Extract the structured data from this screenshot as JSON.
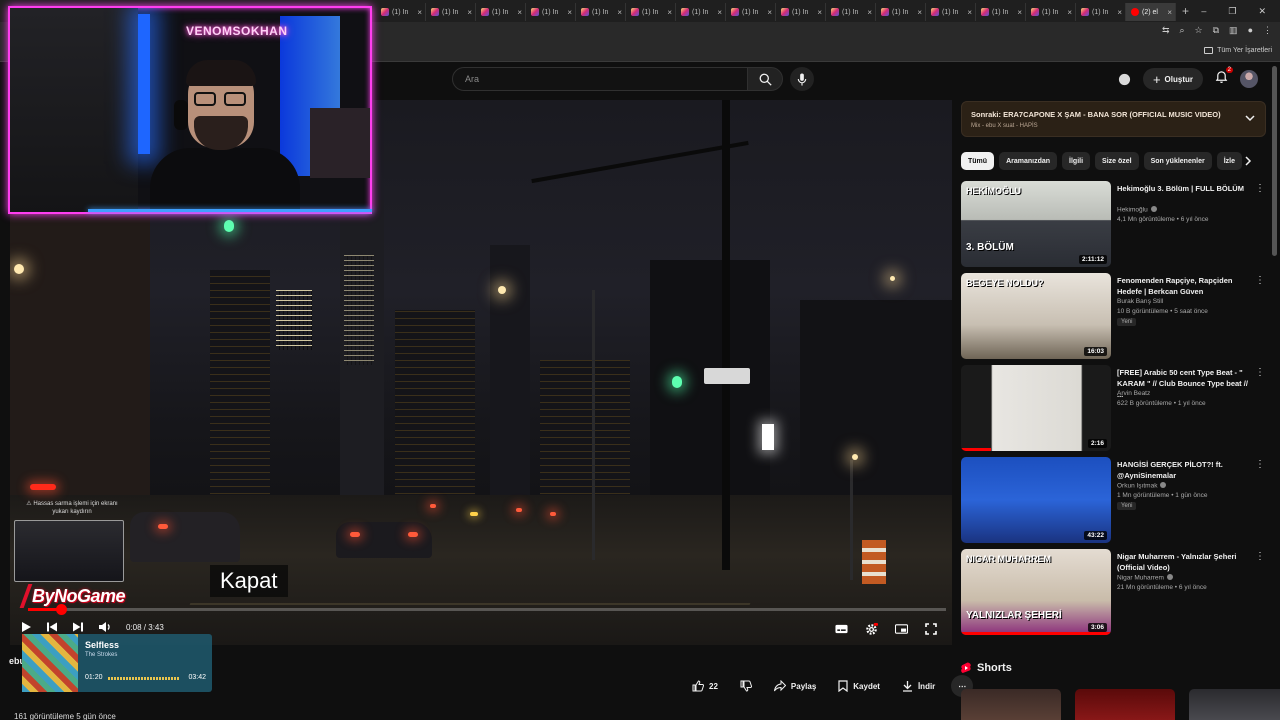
{
  "browser": {
    "tabs": [
      {
        "label": "(1) In",
        "kind": "instagram"
      },
      {
        "label": "(1) In",
        "kind": "instagram"
      },
      {
        "label": "(1) In",
        "kind": "instagram"
      },
      {
        "label": "(1) In",
        "kind": "instagram"
      },
      {
        "label": "(1) In",
        "kind": "instagram"
      },
      {
        "label": "(1) In",
        "kind": "instagram"
      },
      {
        "label": "(1) In",
        "kind": "instagram"
      },
      {
        "label": "(1) In",
        "kind": "instagram"
      },
      {
        "label": "(1) In",
        "kind": "instagram"
      },
      {
        "label": "(1) In",
        "kind": "instagram"
      },
      {
        "label": "(1) In",
        "kind": "instagram"
      },
      {
        "label": "(1) In",
        "kind": "instagram"
      },
      {
        "label": "(1) In",
        "kind": "instagram"
      },
      {
        "label": "(1) In",
        "kind": "instagram"
      },
      {
        "label": "(1) In",
        "kind": "instagram"
      },
      {
        "label": "(2) el",
        "kind": "youtube",
        "active": true
      }
    ],
    "tab_close": "×",
    "new_tab": "+",
    "window_controls": {
      "minimize": "–",
      "maximize": "❐",
      "close": "✕"
    },
    "bookmarks_all": "Tüm Yer İşaretleri"
  },
  "header": {
    "search_placeholder": "Ara",
    "create_label": "Oluştur",
    "notifications_count": "2"
  },
  "player": {
    "caption": "Kapat",
    "time_current": "0:08",
    "time_total": "3:43",
    "progress_fraction": 0.036
  },
  "overlays": {
    "webcam_neon": "VENOMSOKHAN",
    "privacy_hint": "⚠ Hassas sarma işlemi için ekranı yukarı kaydırın",
    "sponsor_logo": "ByNoGame",
    "spotify": {
      "title": "Selfless",
      "artist": "The Strokes",
      "current": "01:20",
      "duration": "03:42"
    },
    "channel_peek": "ebu",
    "views_line": "161 görüntüleme  5 gün önce"
  },
  "actions": {
    "like_count": "22",
    "share": "Paylaş",
    "save": "Kaydet",
    "download": "İndir",
    "more": "⋯"
  },
  "up_next": {
    "title": "Sonraki: ERA7CAPONE X ŞAM - BANA SOR (OFFICIAL MUSIC VIDEO)",
    "subtitle": "Mix - ebu X suat - HAPİS"
  },
  "chips": [
    "Tümü",
    "Aramanızdan",
    "İlgili",
    "Size özel",
    "Son yüklenenler",
    "İzle"
  ],
  "recommendations": [
    {
      "title": "Hekimoğlu 3. Bölüm | FULL BÖLÜM",
      "channel": "Hekimoğlu",
      "verified": true,
      "meta": "4,1 Mn görüntüleme • 6 yıl önce",
      "badge": "",
      "duration": "2:11:12",
      "thumb_text_top": "HEKİMOĞLU",
      "thumb_text_bottom": "3. BÖLÜM",
      "watched_fraction": 0
    },
    {
      "title": "Fenomenden Rapçiye, Rapçiden Hedefe | Berkcan Güven",
      "channel": "Burak Barış Still",
      "verified": false,
      "meta": "10 B görüntüleme • 5 saat önce",
      "badge": "Yeni",
      "duration": "16:03",
      "thumb_text_top": "BEGEYE NOLDU?",
      "thumb_text_bottom": "",
      "watched_fraction": 0
    },
    {
      "title": "[FREE] Arabic 50 cent Type Beat - \" KARAM \" // Club Bounce Type beat // ...",
      "channel": "Arvin Beatz",
      "verified": false,
      "meta": "622 B görüntüleme • 1 yıl önce",
      "badge": "",
      "duration": "2:16",
      "thumb_text_top": "",
      "thumb_text_bottom": "",
      "watched_fraction": 0.2
    },
    {
      "title": "HANGİSİ GERÇEK PİLOT?! ft. @AyniSinemalar",
      "channel": "Orkun Işıtmak",
      "verified": true,
      "meta": "1 Mn görüntüleme • 1 gün önce",
      "badge": "Yeni",
      "duration": "43:22",
      "thumb_text_top": "",
      "thumb_text_bottom": "",
      "watched_fraction": 0
    },
    {
      "title": "Nigar Muharrem - Yalnızlar Şeheri (Official Video)",
      "channel": "Nigar Muharrem",
      "verified": true,
      "meta": "21 Mn görüntüleme • 6 yıl önce",
      "badge": "",
      "duration": "3:06",
      "thumb_text_top": "NIGAR MUHARREM",
      "thumb_text_bottom": "YALNIZLAR ŞEHERİ",
      "watched_fraction": 1
    }
  ],
  "shorts": {
    "title": "Shorts"
  },
  "colors": {
    "accent": "#ff0000",
    "cam_border": "#ff3ef0",
    "upnext_bg": "#2b2116"
  }
}
